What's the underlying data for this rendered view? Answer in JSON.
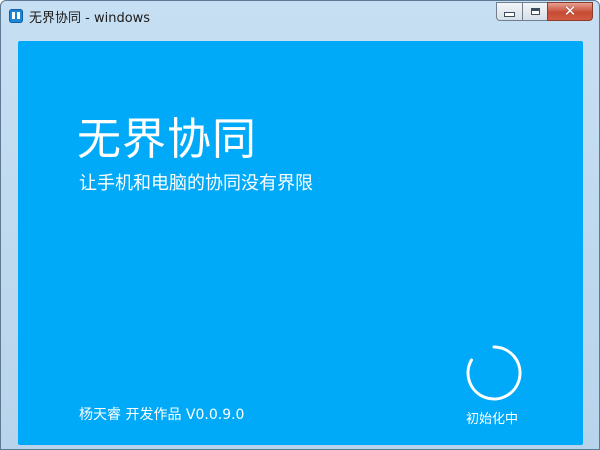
{
  "window": {
    "title": "无界协同 - windows",
    "app_icon": "app-logo-icon",
    "buttons": {
      "minimize_icon": "minimize-icon",
      "maximize_icon": "maximize-icon",
      "close_icon": "close-icon",
      "close_glyph": "✕"
    }
  },
  "splash": {
    "background_color": "#00aaf8",
    "title": "无界协同",
    "subtitle": "让手机和电脑的协同没有界限",
    "credit": "杨天睿 开发作品 V0.0.9.0",
    "status": "初始化中",
    "spinner_icon": "loading-spinner-icon"
  }
}
